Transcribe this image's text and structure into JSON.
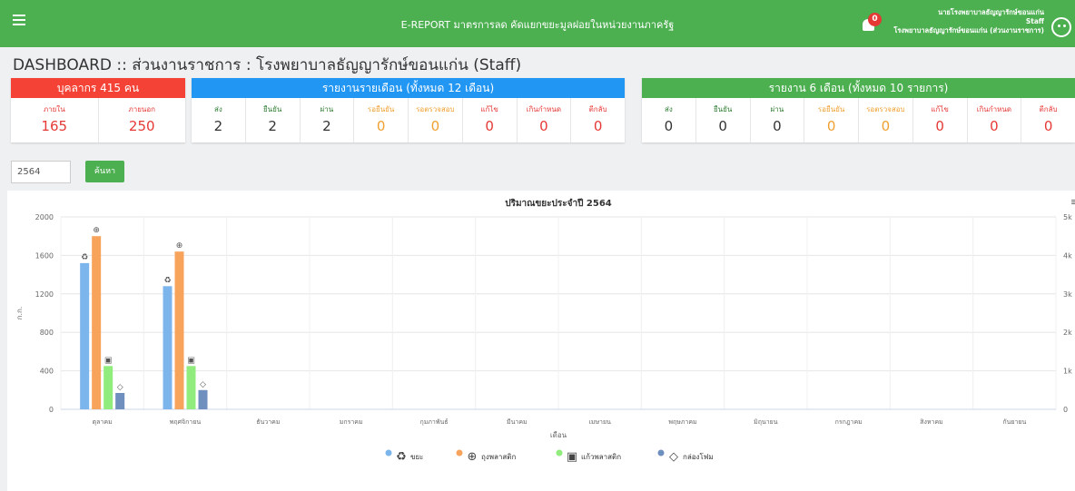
{
  "header": {
    "app_title": "E-REPORT มาตรการลด คัดแยกขยะมูลฝอยในหน่วยงานภาครัฐ",
    "notification_count": "0",
    "user_name": "นายโรงพยาบาลธัญญารักษ์ขอนแก่น",
    "user_role": "Staff",
    "user_org": "โรงพยาบาลธัญญารักษ์ขอนแก่น (ส่วนงานราชการ)"
  },
  "page_title": "DASHBOARD :: ส่วนงานราชการ : โรงพยาบาลธัญญารักษ์ขอนแก่น (Staff)",
  "cards": {
    "personnel": {
      "title": "บุคลากร 415 คน",
      "color": "#f44336",
      "cells": [
        {
          "label": "ภายใน",
          "value": "165"
        },
        {
          "label": "ภายนอก",
          "value": "250"
        }
      ]
    },
    "monthly": {
      "title": "รายงานรายเดือน (ทั้งหมด 12 เดือน)",
      "color": "#2196f3",
      "cells": [
        {
          "label": "ส่ง",
          "value": "2"
        },
        {
          "label": "ยืนยัน",
          "value": "2"
        },
        {
          "label": "ผ่าน",
          "value": "2"
        },
        {
          "label": "รอยืนยัน",
          "value": "0"
        },
        {
          "label": "รอตรวจสอบ",
          "value": "0"
        },
        {
          "label": "แก้ไข",
          "value": "0"
        },
        {
          "label": "เกินกำหนด",
          "value": "0"
        },
        {
          "label": "ตีกลับ",
          "value": "0"
        }
      ]
    },
    "sixmonth": {
      "title": "รายงาน 6 เดือน (ทั้งหมด 10 รายการ)",
      "color": "#4caf50",
      "cells": [
        {
          "label": "ส่ง",
          "value": "0"
        },
        {
          "label": "ยืนยัน",
          "value": "0"
        },
        {
          "label": "ผ่าน",
          "value": "0"
        },
        {
          "label": "รอยืนยัน",
          "value": "0"
        },
        {
          "label": "รอตรวจสอบ",
          "value": "0"
        },
        {
          "label": "แก้ไข",
          "value": "0"
        },
        {
          "label": "เกินกำหนด",
          "value": "0"
        },
        {
          "label": "ตีกลับ",
          "value": "0"
        }
      ]
    }
  },
  "status_colors": {
    "green": "#2e7d32",
    "orange": "#f0a030",
    "red": "#e53935",
    "dark": "#333333"
  },
  "search": {
    "year_value": "2564",
    "button_label": "ค้นหา"
  },
  "chart_data": {
    "type": "bar",
    "title": "ปริมาณขยะประจำปี 2564",
    "xlabel": "เดือน",
    "ylabel": "ก.ก.",
    "categories": [
      "ตุลาคม",
      "พฤศจิกายน",
      "ธันวาคม",
      "มกราคม",
      "กุมภาพันธ์",
      "มีนาคม",
      "เมษายน",
      "พฤษภาคม",
      "มิถุนายน",
      "กรกฎาคม",
      "สิงหาคม",
      "กันยายน"
    ],
    "ylim": [
      0,
      2000
    ],
    "y_ticks": [
      "0",
      "400",
      "800",
      "1200",
      "1600",
      "2000"
    ],
    "y2lim": [
      0,
      5000
    ],
    "y2_ticks": [
      "0",
      "1k",
      "2k",
      "3k",
      "4k",
      "5k"
    ],
    "series": [
      {
        "name": "ขยะ",
        "color": "#7cb5ec",
        "icon": "recycle-icon",
        "values": [
          1520,
          1280,
          0,
          0,
          0,
          0,
          0,
          0,
          0,
          0,
          0,
          0
        ]
      },
      {
        "name": "ถุงพลาสติก",
        "color": "#f7a35c",
        "icon": "plastic-bag-icon",
        "values": [
          1800,
          1640,
          0,
          0,
          0,
          0,
          0,
          0,
          0,
          0,
          0,
          0
        ]
      },
      {
        "name": "แก้วพลาสติก",
        "color": "#90ed7d",
        "icon": "plastic-cup-icon",
        "values": [
          450,
          450,
          0,
          0,
          0,
          0,
          0,
          0,
          0,
          0,
          0,
          0
        ]
      },
      {
        "name": "กล่องโฟม",
        "color": "#6f8fbf",
        "icon": "foam-box-icon",
        "values": [
          170,
          200,
          0,
          0,
          0,
          0,
          0,
          0,
          0,
          0,
          0,
          0
        ]
      }
    ],
    "grid": true,
    "legend": "bottom-center"
  }
}
